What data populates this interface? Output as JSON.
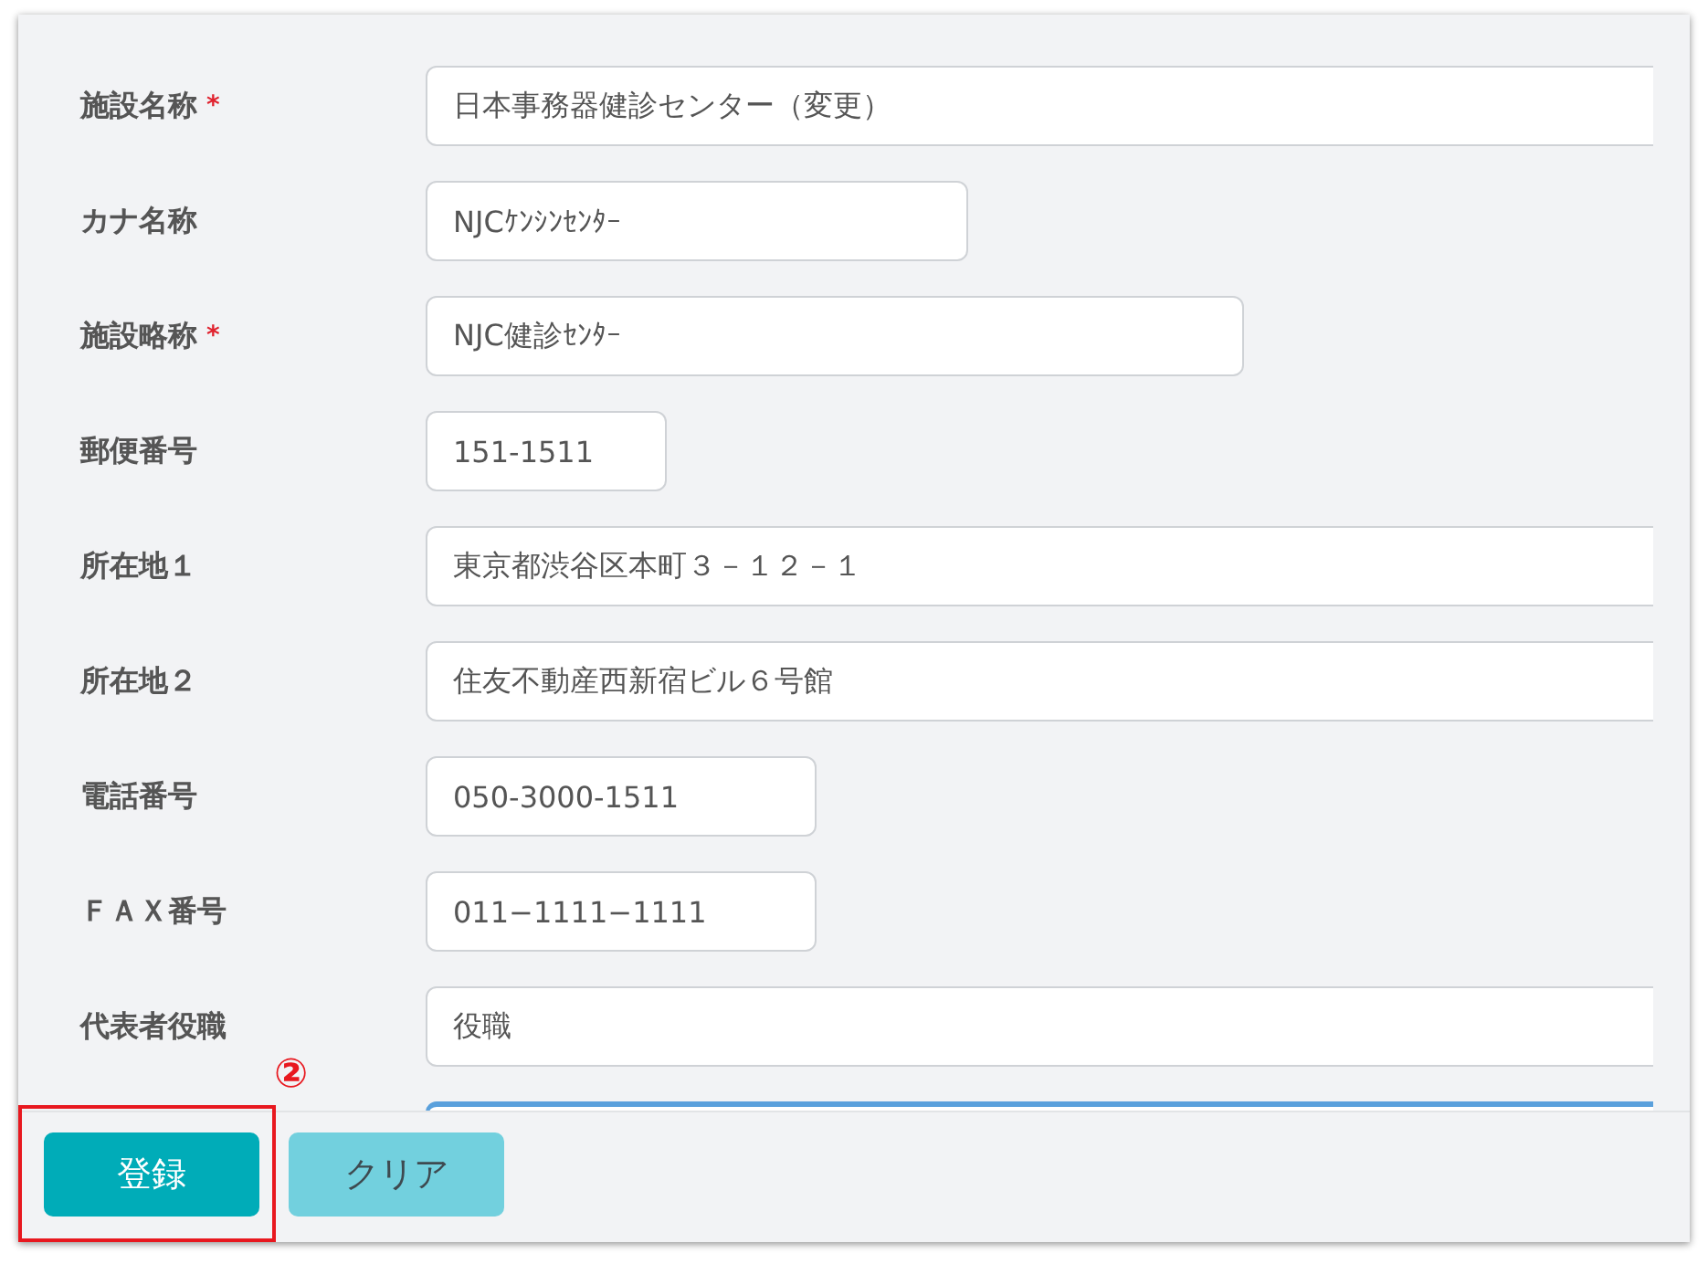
{
  "required_mark": "*",
  "fields": [
    {
      "label": "施設名称",
      "value": "日本事務器健診センター（変更）",
      "required": true
    },
    {
      "label": "カナ名称",
      "value": "NJCｹﾝｼﾝｾﾝﾀｰ",
      "required": false
    },
    {
      "label": "施設略称",
      "value": "NJC健診ｾﾝﾀｰ",
      "required": true
    },
    {
      "label": "郵便番号",
      "value": "151-1511",
      "required": false
    },
    {
      "label": "所在地１",
      "value": "東京都渋谷区本町３－１２－１",
      "required": false
    },
    {
      "label": "所在地２",
      "value": "住友不動産西新宿ビル６号館",
      "required": false
    },
    {
      "label": "電話番号",
      "value": "050-3000-1511",
      "required": false
    },
    {
      "label": "ＦＡＸ番号",
      "value": "011−1111−1111",
      "required": false
    },
    {
      "label": "代表者役職",
      "value": "役職",
      "required": false
    }
  ],
  "partial_field": {
    "focused": true
  },
  "buttons": [
    {
      "label": "登録",
      "kind": "primary"
    },
    {
      "label": "クリア",
      "kind": "secondary"
    }
  ],
  "annotation": {
    "marker": "②"
  }
}
